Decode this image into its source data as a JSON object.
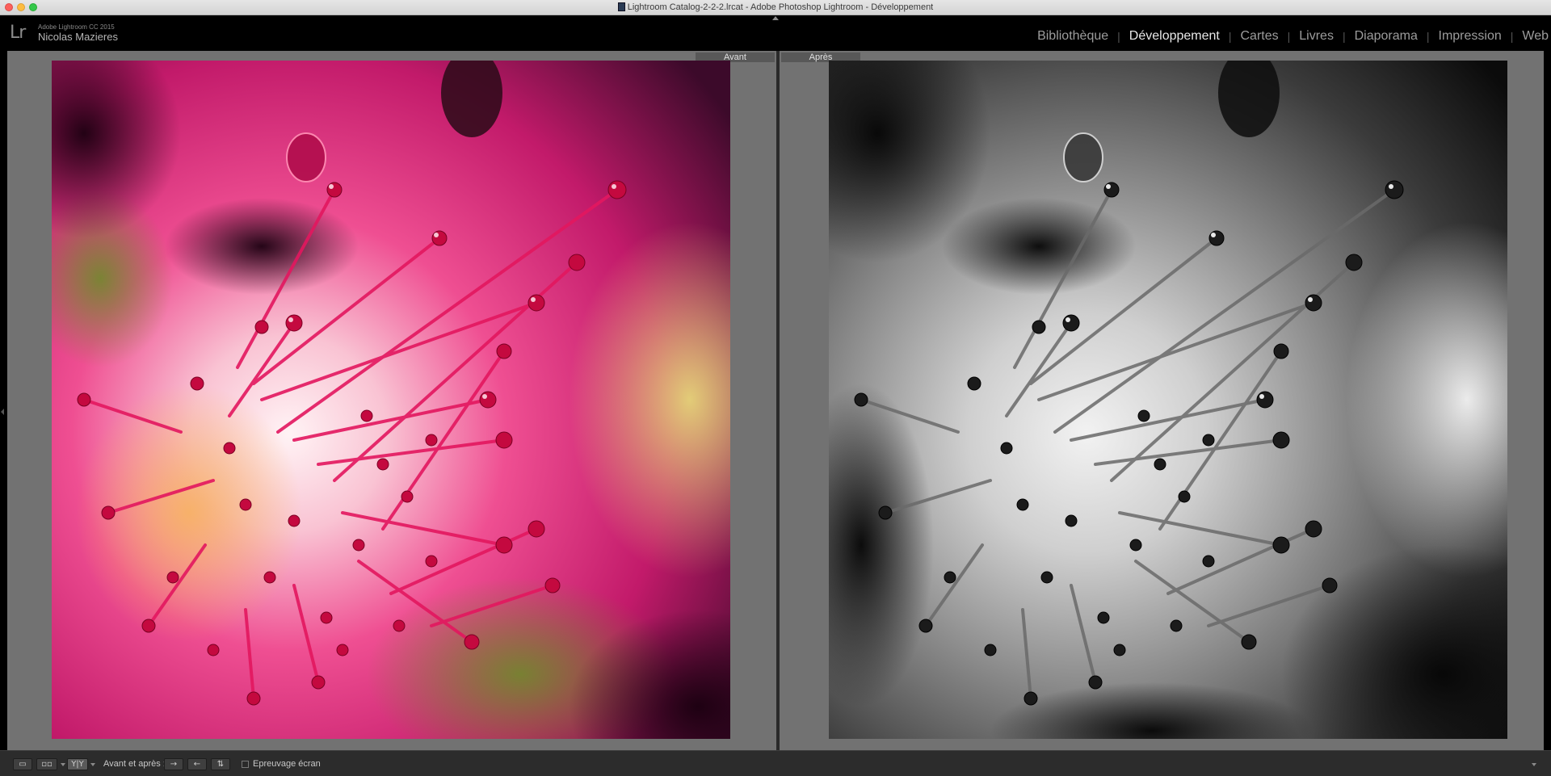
{
  "window": {
    "title": "Lightroom  Catalog-2-2-2.lrcat - Adobe Photoshop Lightroom - Développement"
  },
  "identity": {
    "logo": "Lr",
    "version": "Adobe Lightroom CC 2015",
    "user": "Nicolas Mazieres"
  },
  "modules": [
    {
      "label": "Bibliothèque",
      "active": false
    },
    {
      "label": "Développement",
      "active": true
    },
    {
      "label": "Cartes",
      "active": false
    },
    {
      "label": "Livres",
      "active": false
    },
    {
      "label": "Diaporama",
      "active": false
    },
    {
      "label": "Impression",
      "active": false
    },
    {
      "label": "Web",
      "active": false
    }
  ],
  "panes": {
    "before_label": "Avant",
    "after_label": "Après"
  },
  "toolbar": {
    "view_mode_buttons": [
      "loupe-view-icon",
      "compare-view-icon",
      "before-after-yy-icon"
    ],
    "yy_glyph": "Y|Y",
    "before_after_label": "Avant et après :",
    "proofing_label": "Epreuvage écran",
    "proofing_checked": false
  },
  "colors": {
    "active_module": "#e8e8e8",
    "inactive_module": "#9c9c9c",
    "pane_background": "#727272",
    "photo_magenta": "#e0246e"
  }
}
